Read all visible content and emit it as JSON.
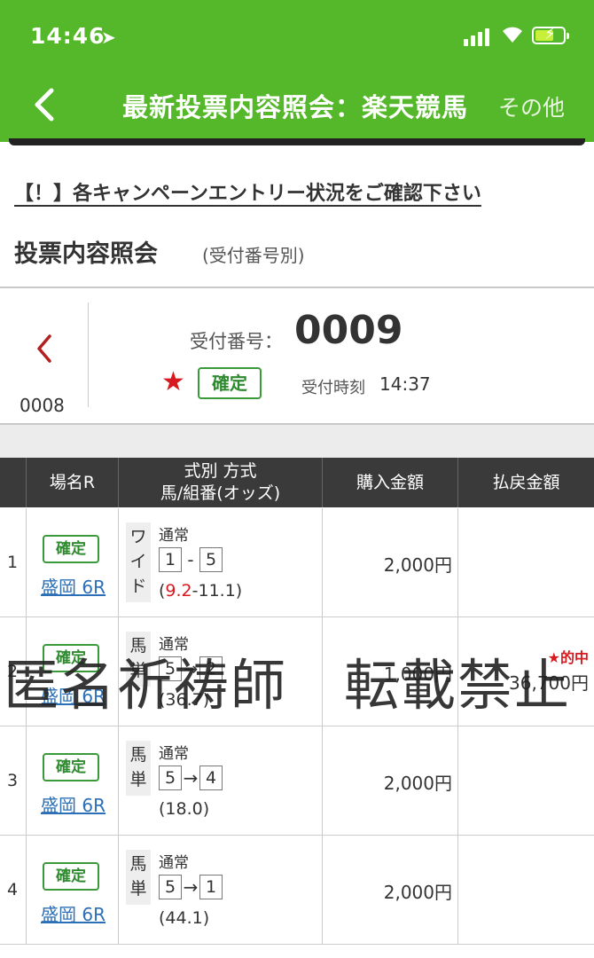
{
  "status": {
    "time": "14:46"
  },
  "header": {
    "title": "最新投票内容照会：楽天競馬",
    "other": "その他"
  },
  "notice": "【！】各キャンペーンエントリー状況をご確認下さい",
  "section": {
    "title": "投票内容照会",
    "subtitle": "(受付番号別)"
  },
  "receipt": {
    "prev_number": "0008",
    "label": "受付番号：",
    "number": "0009",
    "status": "確定",
    "time_label": "受付時刻",
    "time": "14:37"
  },
  "table": {
    "headers": {
      "place": "場名R",
      "bet_line1": "式別 方式",
      "bet_line2": "馬/組番(オッズ)",
      "buy": "購入金額",
      "pay": "払戻金額"
    },
    "rows": [
      {
        "idx": "1",
        "status": "確定",
        "place": "盛岡 6R",
        "type": "ワイド",
        "method": "通常",
        "h1": "1",
        "sep": "-",
        "h2": "5",
        "odds_open": "(",
        "odds_hi": "9.2",
        "odds_rest": "-11.1)",
        "amount": "2,000円",
        "win": "",
        "payout": ""
      },
      {
        "idx": "2",
        "status": "確定",
        "place": "盛岡 6R",
        "type": "馬単",
        "method": "通常",
        "h1": "5",
        "sep": "→",
        "h2": "2",
        "odds_open": "(36.7)",
        "odds_hi": "",
        "odds_rest": "",
        "amount": "1,000円",
        "win": "★的中",
        "payout": "36,700円"
      },
      {
        "idx": "3",
        "status": "確定",
        "place": "盛岡 6R",
        "type": "馬単",
        "method": "通常",
        "h1": "5",
        "sep": "→",
        "h2": "4",
        "odds_open": "(18.0)",
        "odds_hi": "",
        "odds_rest": "",
        "amount": "2,000円",
        "win": "",
        "payout": ""
      },
      {
        "idx": "4",
        "status": "確定",
        "place": "盛岡 6R",
        "type": "馬単",
        "method": "通常",
        "h1": "5",
        "sep": "→",
        "h2": "1",
        "odds_open": "(44.1)",
        "odds_hi": "",
        "odds_rest": "",
        "amount": "2,000円",
        "win": "",
        "payout": ""
      }
    ]
  },
  "watermark": "匿名祈祷師　転載禁止",
  "colors": {
    "header_green": "#55b82a",
    "badge_green": "#2e8a2e",
    "accent_red": "#d71920",
    "link_blue": "#2c6fb6"
  }
}
